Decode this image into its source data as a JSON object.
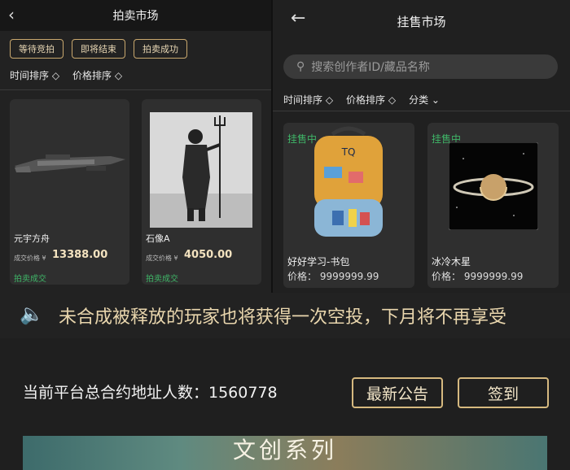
{
  "left": {
    "title": "拍卖市场",
    "buttons": [
      "等待竞拍",
      "即将结束",
      "拍卖成功"
    ],
    "sorts": [
      "时间排序 ◇",
      "价格排序 ◇"
    ],
    "items": [
      {
        "name": "元宇方舟",
        "price_label": "成交价格 ¥",
        "price": "13388.00",
        "status": "拍卖成交"
      },
      {
        "name": "石像A",
        "price_label": "成交价格 ¥",
        "price": "4050.00",
        "status": "拍卖成交"
      }
    ]
  },
  "right": {
    "title": "挂售市场",
    "search_placeholder": "搜索创作者ID/藏品名称",
    "sorts": [
      "时间排序 ◇",
      "价格排序 ◇",
      "分类 ⌄"
    ],
    "items": [
      {
        "tag": "挂售中",
        "name": "好好学习-书包",
        "price": "价格：  9999999.99"
      },
      {
        "tag": "挂售中",
        "name": "冰冷木星",
        "price": "价格：  9999999.99"
      }
    ]
  },
  "announcement": "未合成被释放的玩家也将获得一次空投，下月将不再享受",
  "stats": {
    "label": "当前平台总合约地址人数：1560778"
  },
  "actions": {
    "notice": "最新公告",
    "checkin": "签到"
  },
  "banner": {
    "title": "文创系列"
  }
}
